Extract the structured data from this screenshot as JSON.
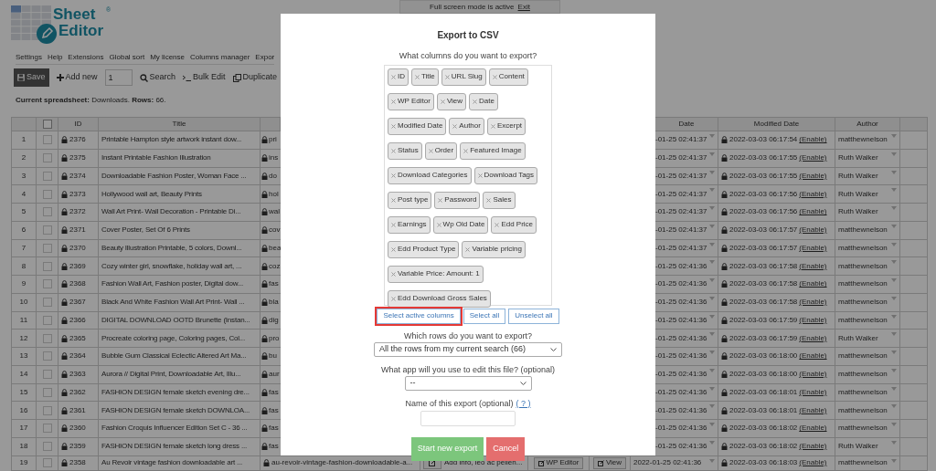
{
  "banner": {
    "text": "Full screen mode is active",
    "link": "Exit"
  },
  "logo": {
    "line1": "Sheet",
    "line2": "Editor",
    "mark": "®"
  },
  "menu": [
    "Settings",
    "Help",
    "Extensions",
    "Global sort",
    "My license",
    "Columns manager",
    "Expor"
  ],
  "toolbar": {
    "save": "Save",
    "add_new": "Add new",
    "add_count": "1",
    "search": "Search",
    "bulk_edit": "Bulk Edit",
    "duplicate": "Duplicate"
  },
  "status": "**Current spreadsheet:** Downloads. **Rows:** 66.",
  "table": {
    "columns": [
      "ID",
      "Title",
      "Date",
      "Modified Date",
      "Author"
    ],
    "all_checked": false,
    "rows": [
      {
        "num": "1",
        "checked": false,
        "id": "2376",
        "title": "Printable Hampton style artwork instant dow...",
        "slug": "pri",
        "date": "-01-25 02:41:37",
        "modified": "2022-03-03 06:17:54",
        "link": "(Enable)",
        "author": "matthewnelson"
      },
      {
        "num": "2",
        "checked": false,
        "id": "2375",
        "title": "Instant Printable Fashion Illustration",
        "slug": "ins",
        "date": "-01-25 02:41:37",
        "modified": "2022-03-03 06:17:55",
        "link": "(Enable)",
        "author": "Ruth Walker"
      },
      {
        "num": "3",
        "checked": false,
        "id": "2374",
        "title": "Downloadable Fashion Poster, Woman Face ...",
        "slug": "do",
        "date": "-01-25 02:41:37",
        "modified": "2022-03-03 06:17:55",
        "link": "(Enable)",
        "author": "Ruth Walker"
      },
      {
        "num": "4",
        "checked": false,
        "id": "2373",
        "title": "Hollywood wall art, Beauty Prints",
        "slug": "hol",
        "date": "-01-25 02:41:37",
        "modified": "2022-03-03 06:17:56",
        "link": "(Enable)",
        "author": "Ruth Walker"
      },
      {
        "num": "5",
        "checked": false,
        "id": "2372",
        "title": "Wall Art Print- Wall Decoration - Printable Di...",
        "slug": "wal",
        "date": "-01-25 02:41:37",
        "modified": "2022-03-03 06:17:56",
        "link": "(Enable)",
        "author": "Ruth Walker"
      },
      {
        "num": "6",
        "checked": false,
        "id": "2371",
        "title": "Cover Poster, Set Of 6 Prints",
        "slug": "cov",
        "date": "-01-25 02:41:37",
        "modified": "2022-03-03 06:17:57",
        "link": "(Enable)",
        "author": "matthewnelson"
      },
      {
        "num": "7",
        "checked": false,
        "id": "2370",
        "title": "Beauty Illustration Printable, 5 colors, Downl...",
        "slug": "bea",
        "date": "-01-25 02:41:37",
        "modified": "2022-03-03 06:17:57",
        "link": "(Enable)",
        "author": "matthewnelson"
      },
      {
        "num": "8",
        "checked": false,
        "id": "2369",
        "title": "Cozy winter girl, snowflake, holiday wall art, ...",
        "slug": "coz",
        "date": "-01-25 02:41:36",
        "modified": "2022-03-03 06:17:58",
        "link": "(Enable)",
        "author": "matthewnelson"
      },
      {
        "num": "9",
        "checked": false,
        "id": "2368",
        "title": "Fashion Wall Art, Fashion poster, Digital dow...",
        "slug": "fas",
        "date": "-01-25 02:41:36",
        "modified": "2022-03-03 06:17:58",
        "link": "(Enable)",
        "author": "matthewnelson"
      },
      {
        "num": "10",
        "checked": false,
        "id": "2367",
        "title": "Black And White Fashion Wall Art Print- Wall ...",
        "slug": "bla",
        "date": "-01-25 02:41:36",
        "modified": "2022-03-03 06:17:58",
        "link": "(Enable)",
        "author": "matthewnelson"
      },
      {
        "num": "11",
        "checked": false,
        "id": "2366",
        "title": "DIGITAL DOWNLOAD OOTD Brunette (Instan...",
        "slug": "dig",
        "date": "-01-25 02:41:36",
        "modified": "2022-03-03 06:17:59",
        "link": "(Enable)",
        "author": "matthewnelson"
      },
      {
        "num": "12",
        "checked": false,
        "id": "2365",
        "title": "Procreate coloring page, Coloring pages, Col...",
        "slug": "pro",
        "date": "-01-25 02:41:36",
        "modified": "2022-03-03 06:17:59",
        "link": "(Enable)",
        "author": "Ruth Walker"
      },
      {
        "num": "13",
        "checked": false,
        "id": "2364",
        "title": "Bubble Gum Classical Eclectic Altered Art Ma...",
        "slug": "bu",
        "date": "-01-25 02:41:36",
        "modified": "2022-03-03 06:18:00",
        "link": "(Enable)",
        "author": "matthewnelson"
      },
      {
        "num": "14",
        "checked": false,
        "id": "2363",
        "title": "Aurora // Digital Print, Downloadable Art, Illu...",
        "slug": "aur",
        "date": "-01-25 02:41:36",
        "modified": "2022-03-03 06:18:00",
        "link": "(Enable)",
        "author": "matthewnelson"
      },
      {
        "num": "15",
        "checked": false,
        "id": "2362",
        "title": "FASHION DESIGN female sketch evening dre...",
        "slug": "fas",
        "date": "-01-25 02:41:36",
        "modified": "2022-03-03 06:18:01",
        "link": "(Enable)",
        "author": "matthewnelson"
      },
      {
        "num": "16",
        "checked": false,
        "id": "2361",
        "title": "FASHION DESIGN female sketch DOWNLOA...",
        "slug": "fas",
        "date": "-01-25 02:41:36",
        "modified": "2022-03-03 06:18:01",
        "link": "(Enable)",
        "author": "matthewnelson"
      },
      {
        "num": "17",
        "checked": false,
        "id": "2360",
        "title": "Fashion Croquis Influencer Edition Set C - 36 ...",
        "slug": "fas",
        "date": "-01-25 02:41:36",
        "modified": "2022-03-03 06:18:02",
        "link": "(Enable)",
        "author": "matthewnelson"
      },
      {
        "num": "18",
        "checked": false,
        "id": "2359",
        "title": "FASHION DESIGN female sketch long dress ...",
        "slug": "fas",
        "date": "-01-25 02:41:36",
        "modified": "2022-03-03 06:18:02",
        "link": "(Enable)",
        "author": "Ruth Walker"
      }
    ],
    "last_row": {
      "num": "19",
      "checked": false,
      "id": "2358",
      "title": "Au Revoir vintage fashion downloadable art ...",
      "slug": "au-revoir-vintage-fashion-downloadable-a...",
      "content": "Add info, leo ac pellen...",
      "wp_editor": "WP Editor",
      "view": "View",
      "date": "2022-01-25 02:41:36",
      "modified": "2022-03-03 06:18:03",
      "link": "(Enable)",
      "author": "matthewnelson"
    }
  },
  "dialog": {
    "title": "Export to CSV",
    "columns_label": "What columns do you want to export?",
    "columns": [
      "ID",
      "Title",
      "URL Slug",
      "Content",
      "WP Editor",
      "View",
      "Date",
      "Modified Date",
      "Author",
      "Excerpt",
      "Status",
      "Order",
      "Featured Image",
      "Download Categories",
      "Download Tags",
      "Post type",
      "Password",
      "Sales",
      "Earnings",
      "Wp Old Date",
      "Edd Price",
      "Edd Product Type",
      "Variable pricing",
      "Variable Price: Amount: 1",
      "Edd Download Gross Sales"
    ],
    "column_buttons": [
      {
        "label": "Select active columns",
        "highlighted": true
      },
      {
        "label": "Select all",
        "highlighted": false
      },
      {
        "label": "Unselect all",
        "highlighted": false
      }
    ],
    "rows_label": "Which rows do you want to export?",
    "rows_value": "All the rows from my current search (66)",
    "app_label": "What app will you use to edit this file? (optional)",
    "app_value": "--",
    "name_label": "Name of this export (optional)",
    "name_help": "( ? )",
    "start": "Start new export",
    "cancel": "Cancel"
  }
}
